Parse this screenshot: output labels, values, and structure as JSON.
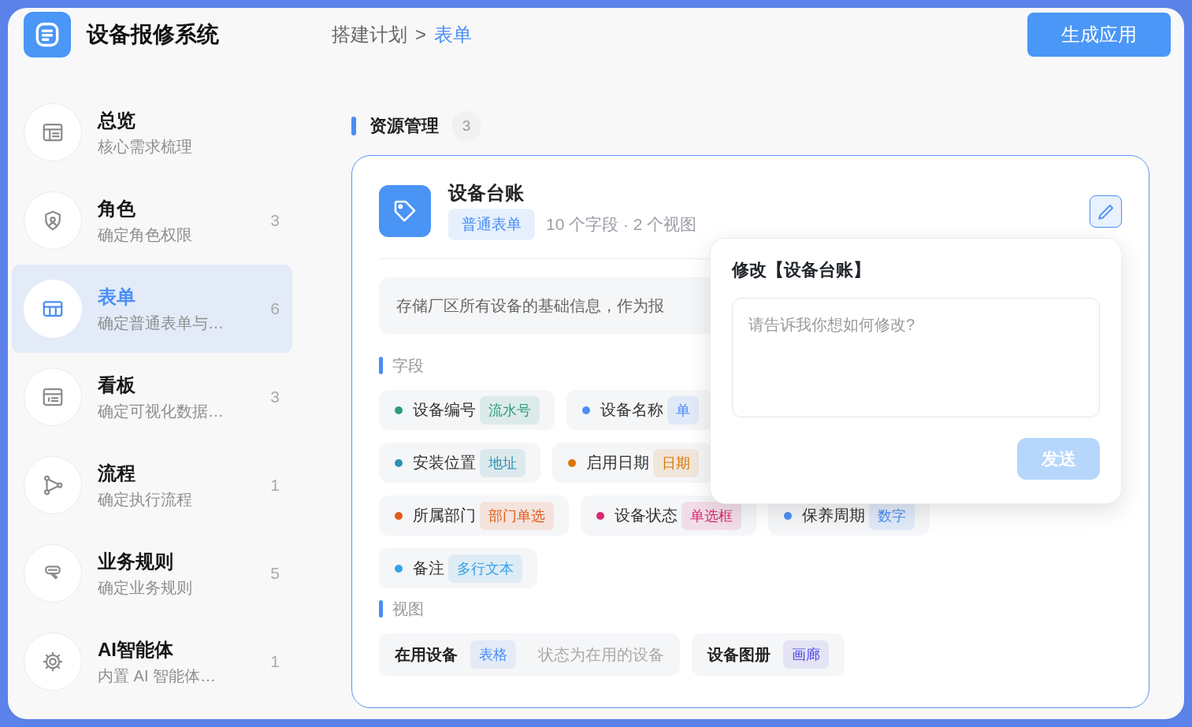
{
  "app": {
    "title": "设备报修系统"
  },
  "breadcrumb": {
    "separator": ">",
    "items": [
      {
        "label": "搭建计划",
        "selected": false
      },
      {
        "label": "表单",
        "selected": true
      }
    ]
  },
  "generate_button": "生成应用",
  "sidebar": {
    "items": [
      {
        "title": "总览",
        "subtitle": "核心需求梳理",
        "selected": false
      },
      {
        "title": "角色",
        "subtitle": "确定角色权限",
        "count": "3",
        "selected": false
      },
      {
        "title": "表单",
        "subtitle": "确定普通表单与…",
        "count": "6",
        "selected": true
      },
      {
        "title": "看板",
        "subtitle": "确定可视化数据…",
        "count": "3",
        "selected": false
      },
      {
        "title": "流程",
        "subtitle": "确定执行流程",
        "count": "1",
        "selected": false
      },
      {
        "title": "业务规则",
        "subtitle": "确定业务规则",
        "count": "5",
        "selected": false
      },
      {
        "title": "AI智能体",
        "subtitle": "内置 AI 智能体…",
        "count": "1",
        "selected": false
      }
    ]
  },
  "section": {
    "title": "资源管理",
    "count": "3"
  },
  "card": {
    "title": "设备台账",
    "tag": "普通表单",
    "meta": "10 个字段 · 2 个视图",
    "description": "存储厂区所有设备的基础信息，作为报",
    "fields_label": "字段",
    "field_rows": [
      [
        {
          "name": "设备编号",
          "type": "流水号",
          "color": "#2a9d7f"
        },
        {
          "name": "设备名称",
          "type": "单",
          "color": "#4a8ef5"
        }
      ],
      [
        {
          "name": "安装位置",
          "type": "地址",
          "color": "#2b90ae"
        },
        {
          "name": "启用日期",
          "type": "日期",
          "color": "#d97706"
        }
      ],
      [
        {
          "name": "所属部门",
          "type": "部门单选",
          "color": "#e35a1a"
        },
        {
          "name": "设备状态",
          "type": "单选框",
          "color": "#d92a72"
        },
        {
          "name": "保养周期",
          "type": "数字",
          "color": "#4a8ef5"
        }
      ],
      [
        {
          "name": "备注",
          "type": "多行文本",
          "color": "#36a3e6"
        }
      ]
    ],
    "views_label": "视图",
    "views": [
      {
        "name": "在用设备",
        "type": "表格",
        "color": "#4a8ef5",
        "description": "状态为在用的设备"
      },
      {
        "name": "设备图册",
        "type": "画廊",
        "color": "#4f46e5"
      }
    ]
  },
  "popover": {
    "title": "修改【设备台账】",
    "placeholder": "请告诉我你想如何修改?",
    "send_button": "发送",
    "disabled": true
  }
}
